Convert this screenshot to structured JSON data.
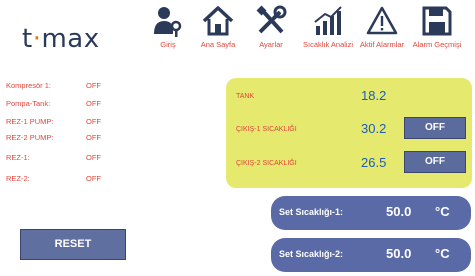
{
  "logo": {
    "prefix": "t",
    "dot": "·",
    "suffix": "max"
  },
  "nav": [
    {
      "label": "Giriş",
      "icon": "user-key-icon"
    },
    {
      "label": "Ana Sayfa",
      "icon": "home-icon"
    },
    {
      "label": "Ayarlar",
      "icon": "tools-icon"
    },
    {
      "label": "Sıcaklık Analizi",
      "icon": "chart-icon"
    },
    {
      "label": "Aktif Alarmlar",
      "icon": "warning-icon"
    },
    {
      "label": "Alarm Geçmişi",
      "icon": "save-icon"
    }
  ],
  "status": [
    {
      "label": "Kompresör 1:",
      "value": "OFF"
    },
    {
      "label": "Pompa-Tank:",
      "value": "OFF"
    },
    {
      "label": "REZ-1 PUMP:",
      "value": "OFF"
    },
    {
      "label": "REZ-2 PUMP:",
      "value": "OFF"
    },
    {
      "label": "REZ-1:",
      "value": "OFF"
    },
    {
      "label": "REZ-2:",
      "value": "OFF"
    }
  ],
  "panel": {
    "tank_label": "TANK",
    "tank_value": "18.2",
    "out1_label": "ÇIKIŞ-1 SICAKLIĞI",
    "out1_value": "30.2",
    "out1_button": "OFF",
    "out2_label": "ÇIKIŞ-2 SICAKLIĞI",
    "out2_value": "26.5",
    "out2_button": "OFF"
  },
  "reset_label": "RESET",
  "setpoints": [
    {
      "label": "Set Sıcaklığı-1:",
      "value": "50.0",
      "unit": "°C"
    },
    {
      "label": "Set Sıcaklığı-2:",
      "value": "50.0",
      "unit": "°C"
    }
  ],
  "colors": {
    "accent_red": "#e0463a",
    "panel_yellow": "#e5ea6f",
    "button_blue": "#5b6b9e",
    "value_blue": "#1f5db8",
    "icon_dark": "#2b3a59"
  }
}
